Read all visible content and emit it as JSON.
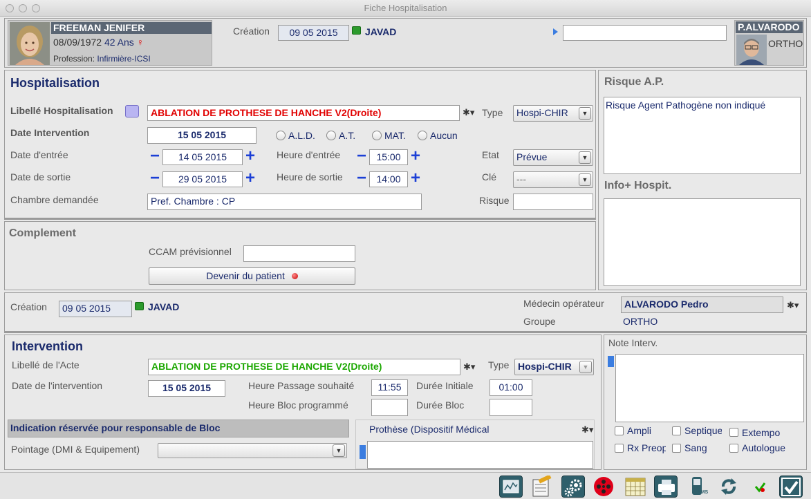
{
  "window": {
    "title": "Fiche Hospitalisation"
  },
  "patient": {
    "name": "FREEMAN  JENIFER",
    "dob": "08/09/1972",
    "age": "42 Ans",
    "gender_symbol": "♀",
    "profession_label": "Profession:",
    "profession": "Infirmière-ICSI"
  },
  "header": {
    "creation_label": "Création",
    "creation_date": "09 05 2015",
    "creation_user": "JAVAD",
    "search_value": ""
  },
  "doctor": {
    "name": "P.ALVARODO",
    "specialty": "ORTHO"
  },
  "hospitalisation": {
    "title": "Hospitalisation",
    "libelle_label": "Libellé Hospitalisation",
    "libelle_value": "ABLATION DE PROTHESE DE HANCHE V2(Droite)",
    "type_label": "Type",
    "type_value": "Hospi-CHIR",
    "date_intervention_label": "Date Intervention",
    "date_intervention_value": "15 05 2015",
    "radio_options": [
      "A.L.D.",
      "A.T.",
      "MAT.",
      "Aucun"
    ],
    "date_entree_label": "Date d'entrée",
    "date_entree_value": "14 05 2015",
    "heure_entree_label": "Heure d'entrée",
    "heure_entree_value": "15:00",
    "etat_label": "Etat",
    "etat_value": "Prévue",
    "date_sortie_label": "Date de sortie",
    "date_sortie_value": "29 05 2015",
    "heure_sortie_label": "Heure de sortie",
    "heure_sortie_value": "14:00",
    "cle_label": "Clé",
    "cle_value": "---",
    "chambre_label": "Chambre demandée",
    "chambre_value": "Pref. Chambre : CP",
    "risque_label": "Risque",
    "risque_value": ""
  },
  "complement": {
    "title": "Complement",
    "ccam_label": "CCAM prévisionnel",
    "ccam_value": "",
    "devenir_label": "Devenir du patient"
  },
  "risque_ap": {
    "title": "Risque A.P.",
    "text": "Risque Agent Pathogène non indiqué"
  },
  "info_hospit": {
    "title": "Info+ Hospit.",
    "text": ""
  },
  "operateur": {
    "creation_label": "Création",
    "creation_date": "09 05 2015",
    "creation_user": "JAVAD",
    "medecin_label": "Médecin opérateur",
    "medecin_value": "ALVARODO Pedro",
    "groupe_label": "Groupe",
    "groupe_value": "ORTHO"
  },
  "intervention": {
    "title": "Intervention",
    "libelle_label": "Libellé de l'Acte",
    "libelle_value": "ABLATION DE PROTHESE DE HANCHE V2(Droite)",
    "type_label": "Type",
    "type_value": "Hospi-CHIR",
    "date_label": "Date de l'intervention",
    "date_value": "15 05 2015",
    "heure_passage_label": "Heure Passage souhaité",
    "heure_passage_value": "11:55",
    "duree_initiale_label": "Durée Initiale",
    "duree_initiale_value": "01:00",
    "heure_bloc_label": "Heure Bloc programmé",
    "heure_bloc_value": "",
    "duree_bloc_label": "Durée Bloc",
    "duree_bloc_value": ""
  },
  "bloc": {
    "title": "Indication réservée pour responsable de Bloc",
    "pointage_label": "Pointage (DMI & Equipement)",
    "pointage_value": ""
  },
  "prothese": {
    "title": "Prothèse (Dispositif Médical",
    "text": ""
  },
  "note_interv": {
    "title": "Note Interv.",
    "text": "",
    "checkboxes": [
      "Ampli",
      "Septique",
      "Extempo",
      "Rx Preop",
      "Sang",
      "Autologue"
    ]
  },
  "toolbar": {
    "icons": [
      "chart-icon",
      "notes-icon",
      "settings-icon",
      "film-reel-icon",
      "calendar-icon",
      "printer-icon",
      "sms-icon",
      "refresh-icon",
      "check-small-icon",
      "validate-icon"
    ],
    "sms_label": "SMS"
  },
  "colors": {
    "navy": "#1a2a6c",
    "red": "#e10000",
    "green": "#1ba700",
    "header_dark": "#5b6674",
    "toolbar_teal": "#2f5f6b"
  }
}
